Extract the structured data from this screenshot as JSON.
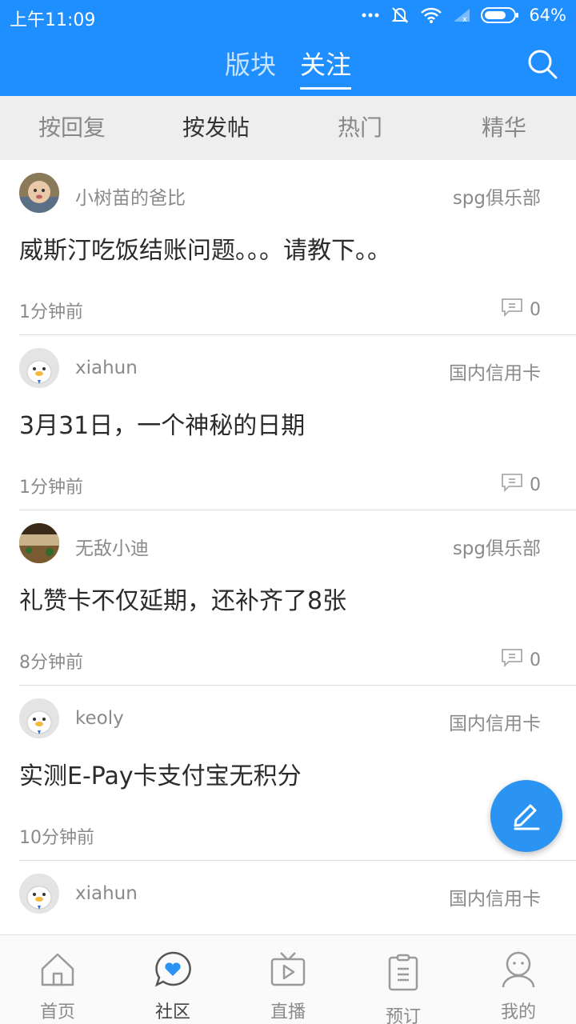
{
  "status_bar": {
    "time": "上午11:09",
    "battery": "64%"
  },
  "header": {
    "tabs": [
      {
        "label": "版块",
        "active": false
      },
      {
        "label": "关注",
        "active": true
      }
    ]
  },
  "filters": [
    {
      "label": "按回复",
      "active": false
    },
    {
      "label": "按发帖",
      "active": true
    },
    {
      "label": "热门",
      "active": false
    },
    {
      "label": "精华",
      "active": false
    }
  ],
  "posts": [
    {
      "author": "小树苗的爸比",
      "forum": "spg俱乐部",
      "title": "威斯汀吃饭结账问题。。。请教下。。",
      "time": "1分钟前",
      "replies": "0",
      "avatar": "baby-photo"
    },
    {
      "author": "xiahun",
      "forum": "国内信用卡",
      "title": "3月31日，一个神秘的日期",
      "time": "1分钟前",
      "replies": "0",
      "avatar": "default-duck"
    },
    {
      "author": "无敌小迪",
      "forum": "spg俱乐部",
      "title": "礼赞卡不仅延期，还补齐了8张",
      "time": "8分钟前",
      "replies": "0",
      "avatar": "landscape-photo"
    },
    {
      "author": "keoly",
      "forum": "国内信用卡",
      "title": "实测E-Pay卡支付宝无积分",
      "time": "10分钟前",
      "replies": "",
      "avatar": "default-duck"
    },
    {
      "author": "xiahun",
      "forum": "国内信用卡",
      "title": "",
      "time": "",
      "replies": "",
      "avatar": "default-duck"
    }
  ],
  "bottom_nav": [
    {
      "label": "首页",
      "icon": "home-icon",
      "active": false
    },
    {
      "label": "社区",
      "icon": "community-icon",
      "active": true
    },
    {
      "label": "直播",
      "icon": "tv-icon",
      "active": false
    },
    {
      "label": "预订",
      "icon": "booking-icon",
      "active": false
    },
    {
      "label": "我的",
      "icon": "profile-icon",
      "active": false
    }
  ],
  "colors": {
    "primary": "#1f8fff",
    "fab": "#2b94f2",
    "filter_bg": "#eeeeee"
  }
}
